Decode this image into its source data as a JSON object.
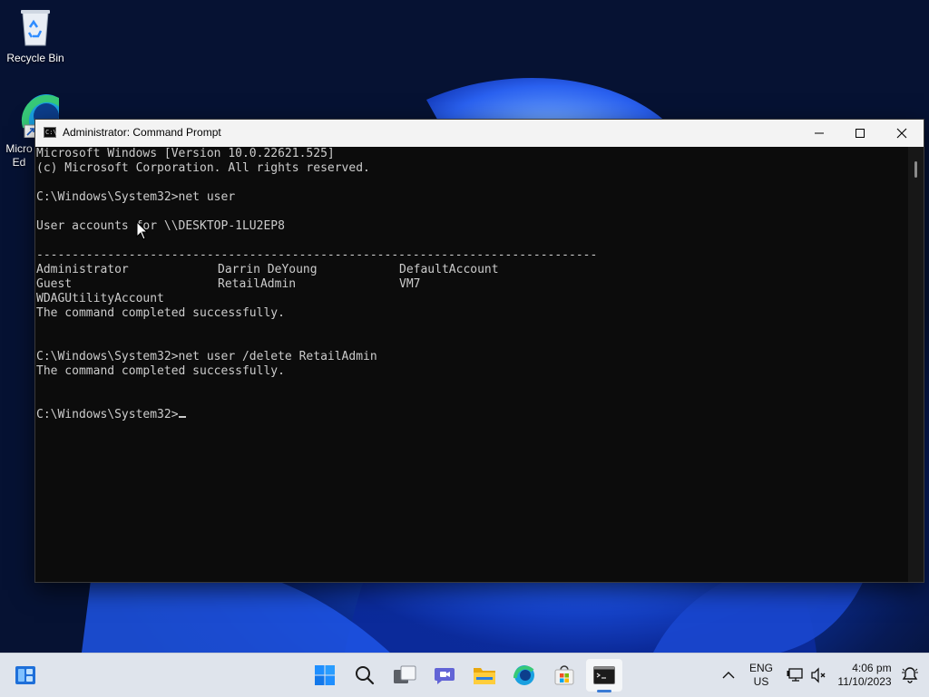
{
  "desktop": {
    "icons": [
      {
        "label": "Recycle Bin",
        "icon": "recycle-bin-icon"
      },
      {
        "label": "Micro Ed",
        "icon": "edge-icon"
      }
    ]
  },
  "window": {
    "title": "Administrator: Command Prompt",
    "icon": "command-prompt-icon",
    "controls": [
      "minimize",
      "maximize",
      "close"
    ]
  },
  "console": {
    "lines": [
      "Microsoft Windows [Version 10.0.22621.525]",
      "(c) Microsoft Corporation. All rights reserved.",
      "",
      "C:\\Windows\\System32>net user",
      "",
      "User accounts for \\\\DESKTOP-1LU2EP8",
      "",
      "-------------------------------------------------------------------------------"
    ],
    "accounts": [
      [
        "Administrator",
        "Darrin DeYoung",
        "DefaultAccount"
      ],
      [
        "Guest",
        "RetailAdmin",
        "VM7"
      ],
      [
        "WDAGUtilityAccount",
        "",
        ""
      ]
    ],
    "after_accounts": [
      "The command completed successfully.",
      "",
      "",
      "C:\\Windows\\System32>net user /delete RetailAdmin",
      "The command completed successfully.",
      "",
      ""
    ],
    "prompt": "C:\\Windows\\System32>",
    "text_color": "#cccccc",
    "background": "#0c0c0c"
  },
  "taskbar": {
    "items": [
      {
        "name": "widgets",
        "icon": "widgets-icon"
      },
      {
        "name": "start",
        "icon": "windows-start-icon"
      },
      {
        "name": "search",
        "icon": "search-icon"
      },
      {
        "name": "task-view",
        "icon": "task-view-icon"
      },
      {
        "name": "chat",
        "icon": "teams-chat-icon"
      },
      {
        "name": "file-explorer",
        "icon": "folder-icon"
      },
      {
        "name": "edge",
        "icon": "edge-icon"
      },
      {
        "name": "store",
        "icon": "store-icon"
      },
      {
        "name": "command-prompt",
        "icon": "command-prompt-icon",
        "active": true
      }
    ],
    "tray": {
      "language_top": "ENG",
      "language_bottom": "US",
      "time": "4:06 pm",
      "date": "11/10/2023"
    },
    "accent": "#3a7bd5"
  }
}
